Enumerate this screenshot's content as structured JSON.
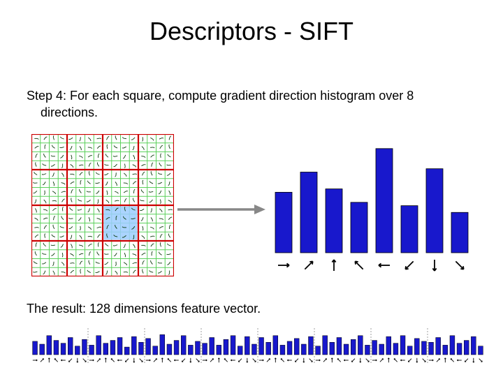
{
  "title": "Descriptors - SIFT",
  "step_line1": "Step 4: For each square, compute gradient direction histogram over 8",
  "step_line2": "directions.",
  "result_line": "The result: 128 dimensions feature vector.",
  "grid": {
    "fine_n": 16,
    "coarse_n": 4,
    "highlighted_coarse_index": {
      "row": 2,
      "col": 2
    }
  },
  "chart_data": {
    "type": "bar",
    "title": "Gradient direction histogram (one cell)",
    "categories": [
      "E",
      "NE",
      "N",
      "NW",
      "W",
      "SW",
      "S",
      "SE"
    ],
    "values": [
      90,
      120,
      95,
      75,
      155,
      70,
      125,
      60
    ],
    "ylim": [
      0,
      160
    ]
  },
  "feature_vector": {
    "groups": 8,
    "directions": [
      "E",
      "NE",
      "N",
      "NW",
      "W",
      "SW",
      "S",
      "SE"
    ],
    "values": [
      [
        14,
        11,
        20,
        15,
        12,
        18,
        9,
        16
      ],
      [
        10,
        20,
        12,
        15,
        18,
        8,
        19,
        13
      ],
      [
        17,
        9,
        21,
        11,
        15,
        20,
        10,
        14
      ],
      [
        12,
        18,
        10,
        16,
        20,
        9,
        19,
        11
      ],
      [
        18,
        13,
        20,
        10,
        14,
        17,
        11,
        19
      ],
      [
        9,
        20,
        13,
        18,
        11,
        16,
        20,
        10
      ],
      [
        15,
        11,
        19,
        12,
        20,
        9,
        17,
        14
      ],
      [
        13,
        18,
        10,
        20,
        12,
        15,
        19,
        9
      ]
    ]
  },
  "direction_angles_deg": {
    "E": 0,
    "NE": 45,
    "N": 90,
    "NW": 135,
    "W": 180,
    "SW": 225,
    "S": 270,
    "SE": 315
  },
  "colors": {
    "bar": "#1818cc",
    "red_grid": "#cc0000",
    "green_grid": "#5bd05b",
    "highlight": "#9cccff"
  }
}
